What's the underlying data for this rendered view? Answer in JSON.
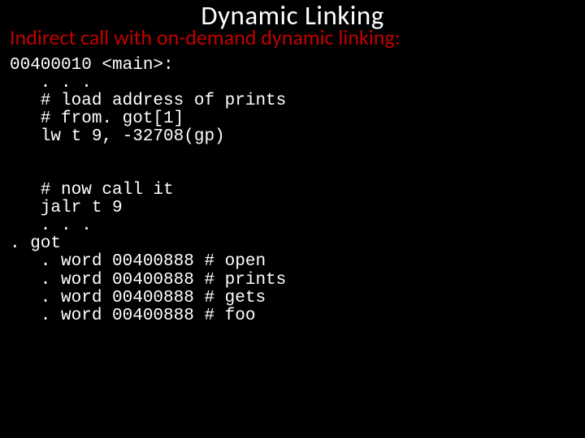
{
  "title": "Dynamic  Linking",
  "subtitle": "Indirect call with on-demand dynamic linking:",
  "code": {
    "l01": "00400010 <main>:",
    "l02": "   . . .",
    "l03": "   # load address of prints",
    "l04": "   # from. got[1]",
    "l05": "   lw t 9, -32708(gp)",
    "l06": "",
    "l07": "",
    "l08": "   # now call it",
    "l09": "   jalr t 9",
    "l10": "   . . .",
    "l11": ". got",
    "l12": "   . word 00400888 # open",
    "l13": "   . word 00400888 # prints",
    "l14": "   . word 00400888 # gets",
    "l15": "   . word 00400888 # foo"
  }
}
